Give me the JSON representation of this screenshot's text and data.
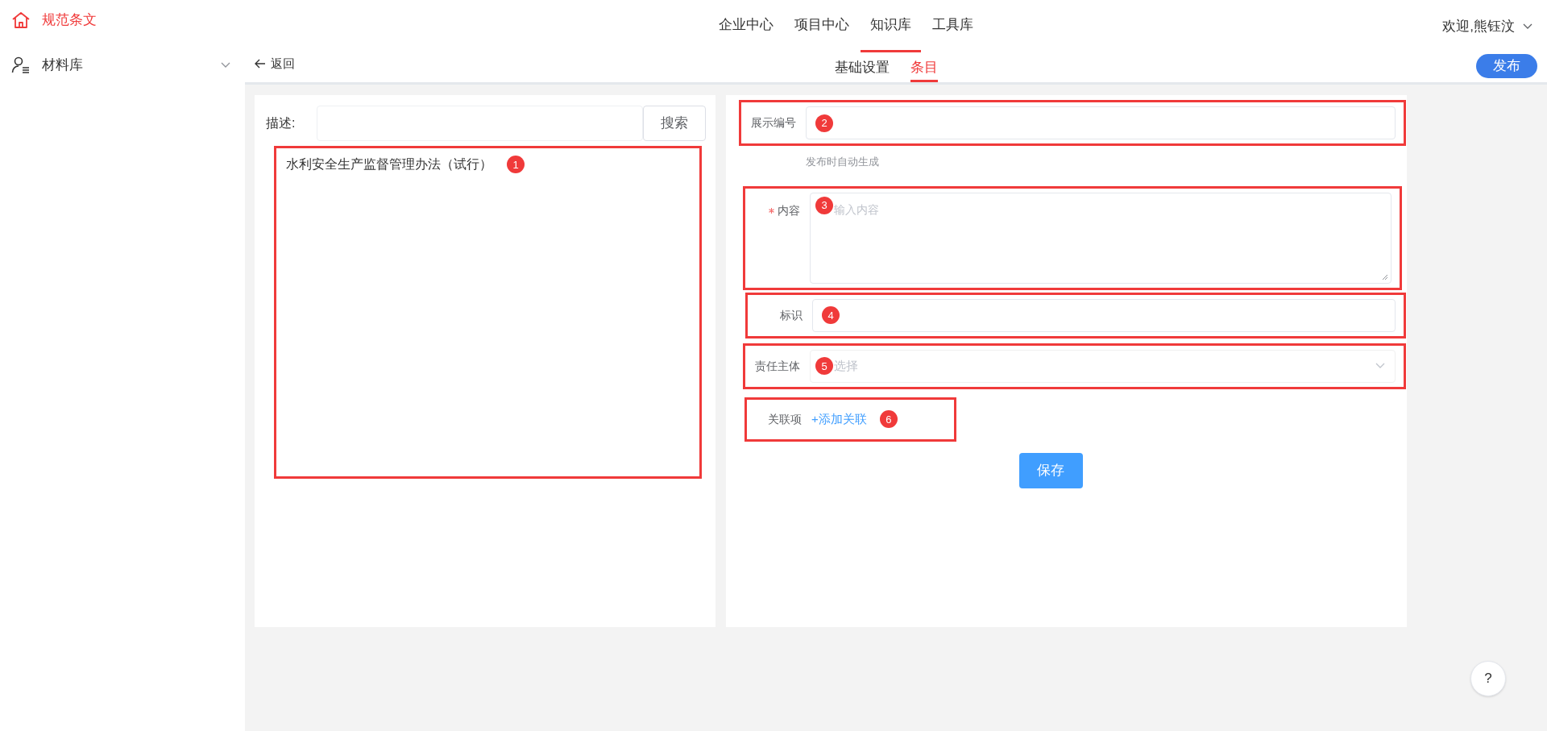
{
  "sidebar": {
    "title": "规范条文",
    "items": [
      {
        "label": "材料库",
        "expanded": false
      }
    ]
  },
  "nav": {
    "items": [
      {
        "label": "企业中心",
        "selected": false
      },
      {
        "label": "项目中心",
        "selected": false
      },
      {
        "label": "知识库",
        "selected": true
      },
      {
        "label": "工具库",
        "selected": false
      }
    ]
  },
  "user": {
    "greeting": "欢迎,熊钰汶"
  },
  "back": "返回",
  "tabs": [
    {
      "label": "基础设置",
      "selected": false
    },
    {
      "label": "条目",
      "selected": true
    }
  ],
  "publish_button": "发布",
  "search": {
    "label": "描述:",
    "button": "搜索"
  },
  "document_list": {
    "badge": "1",
    "items": [
      {
        "title": "水利安全生产监督管理办法（试行）"
      }
    ]
  },
  "form": {
    "fields": [
      {
        "kind": "input",
        "label": "展示编号",
        "badge": "2",
        "hint": "发布时自动生成",
        "required": false
      },
      {
        "kind": "textarea",
        "label": "内容",
        "badge": "3",
        "placeholder": "输入内容",
        "required": true
      },
      {
        "kind": "input",
        "label": "标识",
        "badge": "4",
        "required": false
      },
      {
        "kind": "select",
        "label": "责任主体",
        "badge": "5",
        "placeholder": "选择",
        "required": false
      },
      {
        "kind": "link",
        "label": "关联项",
        "badge": "6",
        "link": "+添加关联",
        "required": false
      }
    ],
    "save_button": "保存"
  },
  "help_button": "?"
}
